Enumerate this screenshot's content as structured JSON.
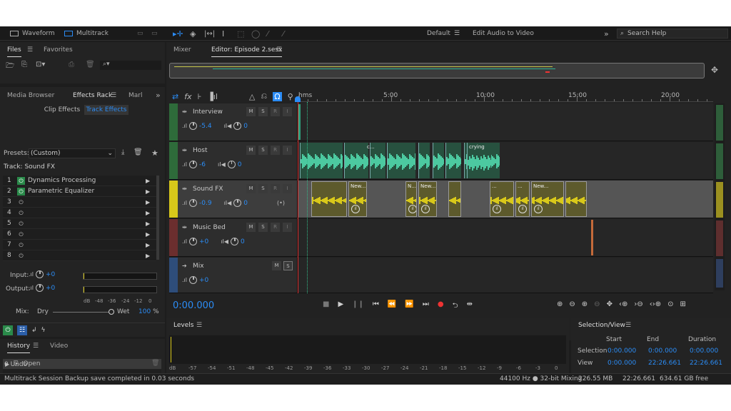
{
  "workspace": {
    "waveform_label": "Waveform",
    "multitrack_label": "Multitrack",
    "default_label": "Default",
    "edit_to_video_label": "Edit Audio to Video",
    "search_placeholder": "Search Help"
  },
  "files_panel": {
    "tab_files": "Files",
    "tab_favorites": "Favorites"
  },
  "effects_panel": {
    "tab_media": "Media Browser",
    "tab_effects": "Effects Rack",
    "tab_markers": "Marl",
    "sub_clip": "Clip Effects",
    "sub_track": "Track Effects",
    "presets_label": "Presets:",
    "preset_value": "(Custom)",
    "track_label": "Track: Sound FX",
    "slots": [
      {
        "n": "1",
        "name": "Dynamics Processing"
      },
      {
        "n": "2",
        "name": "Parametric Equalizer"
      },
      {
        "n": "3",
        "name": ""
      },
      {
        "n": "4",
        "name": ""
      },
      {
        "n": "5",
        "name": ""
      },
      {
        "n": "6",
        "name": ""
      },
      {
        "n": "7",
        "name": ""
      },
      {
        "n": "8",
        "name": ""
      }
    ],
    "input_label": "Input:",
    "input_value": "+0",
    "output_label": "Output:",
    "output_value": "+0",
    "meter_ticks": [
      "dB",
      "-48",
      "-36",
      "-24",
      "-12",
      "0"
    ],
    "mix_label": "Mix:",
    "dry_label": "Dry",
    "wet_label": "Wet",
    "wet_value": "100",
    "wet_unit": "%"
  },
  "history_panel": {
    "tab_history": "History",
    "tab_video": "Video",
    "item": "Open",
    "undo_count": "0 Undo"
  },
  "editor": {
    "tab_mixer": "Mixer",
    "tab_editor": "Editor: Episode 2.sesx",
    "ruler": [
      "hms",
      "5:00",
      "10:00",
      "15:00",
      "20:00"
    ],
    "time_display": "0:00.000",
    "tracks": [
      {
        "name": "Interview",
        "volume": "-5.4",
        "pan": "0",
        "color": "#2e6b3a"
      },
      {
        "name": "Host",
        "volume": "-6",
        "pan": "0",
        "color": "#2e6b3a"
      },
      {
        "name": "Sound FX",
        "volume": "-0.9",
        "pan": "0",
        "color": "#d8c81a"
      },
      {
        "name": "Music Bed",
        "volume": "+0",
        "pan": "0",
        "color": "#6b2e2e"
      },
      {
        "name": "Mix",
        "volume": "+0",
        "color": "#2e4d7a"
      }
    ],
    "host_clip_labels": [
      "c...",
      "crying"
    ],
    "fx_clip_labels": [
      "New...",
      "N...",
      "New...",
      "...",
      "...",
      "New..."
    ]
  },
  "levels_panel": {
    "title": "Levels",
    "ticks": [
      "dB",
      "-57",
      "-54",
      "-51",
      "-48",
      "-45",
      "-42",
      "-39",
      "-36",
      "-33",
      "-30",
      "-27",
      "-24",
      "-21",
      "-18",
      "-15",
      "-12",
      "-9",
      "-6",
      "-3",
      "0"
    ]
  },
  "selection_panel": {
    "title": "Selection/View",
    "col_start": "Start",
    "col_end": "End",
    "col_duration": "Duration",
    "selection_label": "Selection",
    "selection_start": "0:00.000",
    "selection_end": "0:00.000",
    "selection_duration": "0:00.000",
    "view_label": "View",
    "view_start": "0:00.000",
    "view_end": "22:26.661",
    "view_duration": "22:26.661"
  },
  "status_bar": {
    "message": "Multitrack Session Backup save completed in 0.03 seconds",
    "sample_info": "44100 Hz ● 32-bit Mixing",
    "memory": "226.55 MB",
    "duration": "22:26.661",
    "disk_free": "634.61 GB free"
  },
  "colors": {
    "accent": "#2b8cf5",
    "record": "#e33",
    "sfx_yellow": "#d8c81a",
    "host_green": "#3fae8c"
  }
}
